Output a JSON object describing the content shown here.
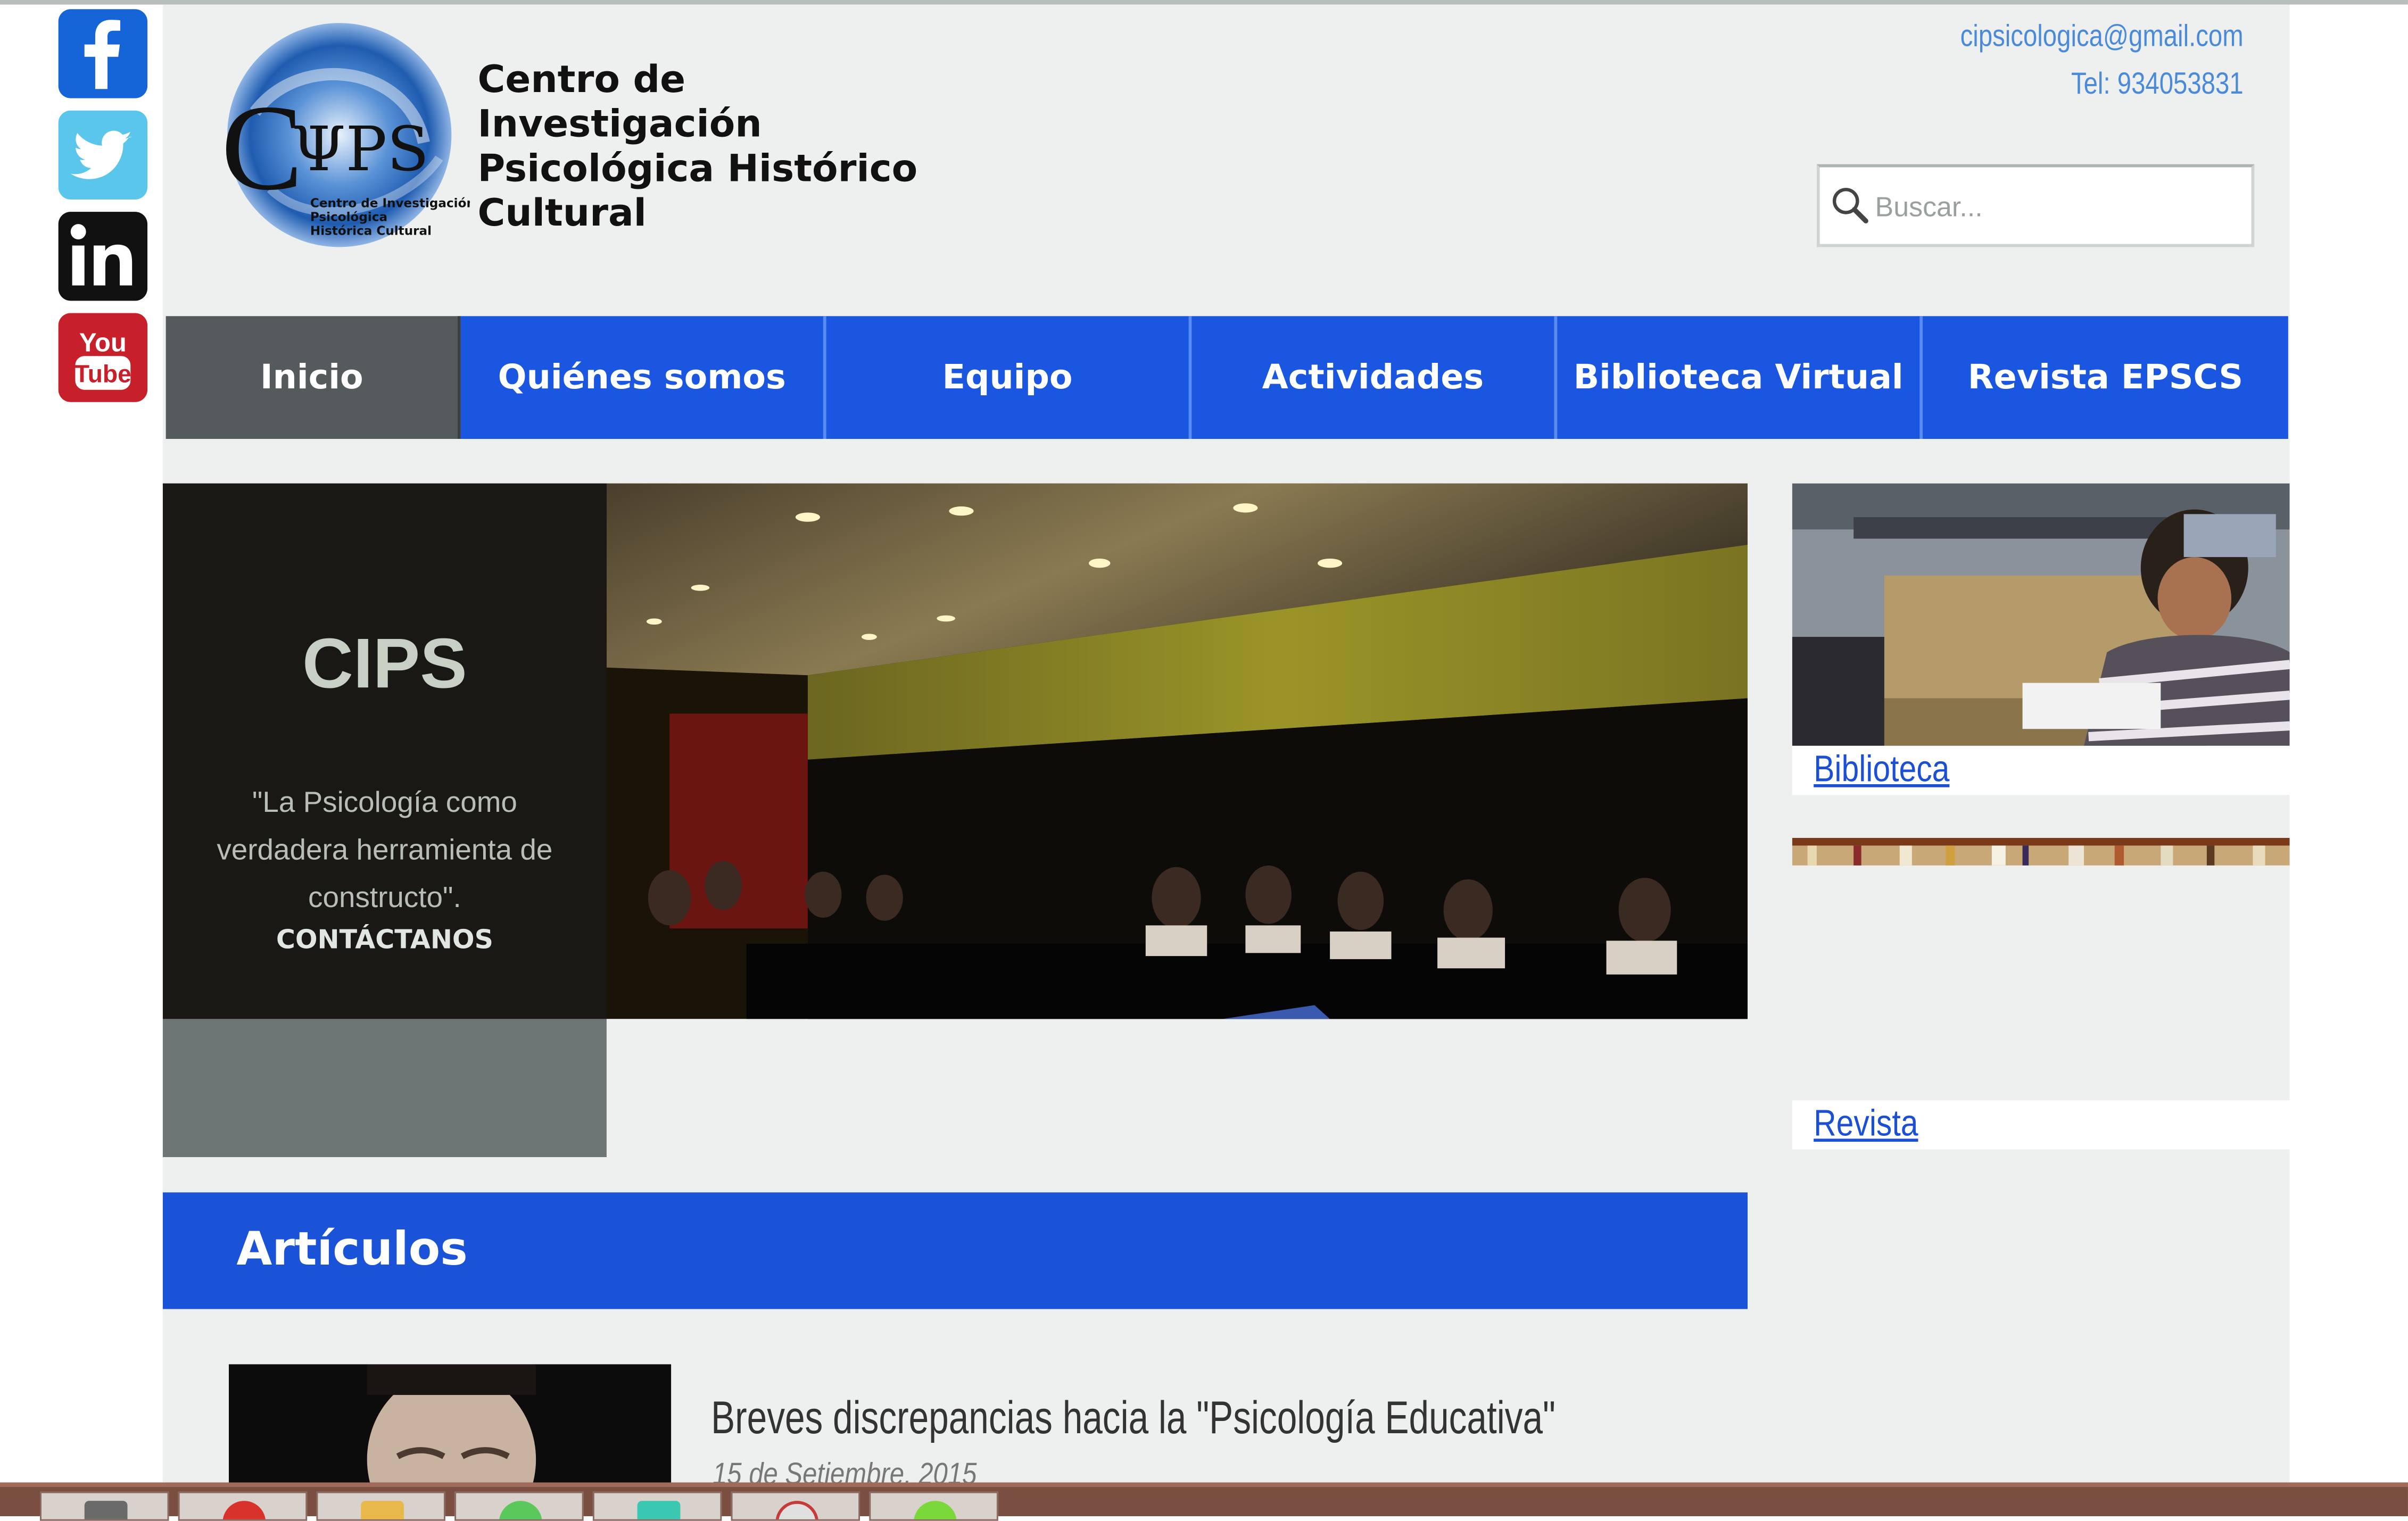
{
  "social": [
    {
      "name": "facebook-icon",
      "label": "f"
    },
    {
      "name": "twitter-icon",
      "label": "twitter"
    },
    {
      "name": "linkedin-icon",
      "label": "in"
    },
    {
      "name": "youtube-icon",
      "label": "YouTube"
    }
  ],
  "header": {
    "logo_text": "CΨPS",
    "logo_subtext": [
      "Centro de Investigación",
      "Psicológica",
      "Histórica Cultural"
    ],
    "org_name": [
      "Centro de",
      "Investigación",
      "Psicológica Histórico",
      "Cultural"
    ],
    "email": "cipsicologica@gmail.com",
    "phone": "Tel: 934053831"
  },
  "search": {
    "placeholder": "Buscar..."
  },
  "nav": {
    "items": [
      "Inicio",
      "Quiénes somos",
      "Equipo",
      "Actividades",
      "Biblioteca Virtual",
      "Revista EPSCS"
    ],
    "active_index": 0
  },
  "hero": {
    "title": "CIPS",
    "quote": "\"La Psicología como verdadera herramienta de constructo\".",
    "cta": "CONTÁCTANOS"
  },
  "sidebar": {
    "biblioteca_label": "Biblioteca",
    "revista_label": "Revista"
  },
  "articles": {
    "heading": "Artículos",
    "items": [
      {
        "title": "Breves discrepancias hacia la \"Psicología Educativa\"",
        "date": "15 de Setiembre, 2015"
      }
    ]
  },
  "colors": {
    "nav_blue": "#1a56e0",
    "nav_active": "#555b5c",
    "link_blue": "#1a4fd6",
    "page_bg": "#eef0f0",
    "taskbar": "#7a4e40"
  }
}
